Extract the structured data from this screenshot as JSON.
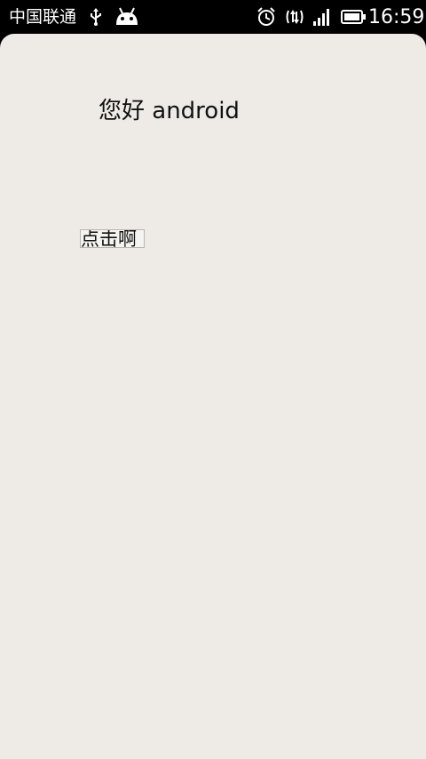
{
  "status_bar": {
    "carrier": "中国联通",
    "time": "16:59",
    "icons": [
      "usb-icon",
      "android-debug-icon",
      "alarm-icon",
      "data-sync-icon",
      "signal-icon",
      "battery-icon"
    ]
  },
  "main": {
    "greeting": "您好 android",
    "button_label": "点击啊"
  },
  "colors": {
    "status_bar_bg": "#000000",
    "surface_bg": "#eeebe6",
    "text": "#111111"
  }
}
